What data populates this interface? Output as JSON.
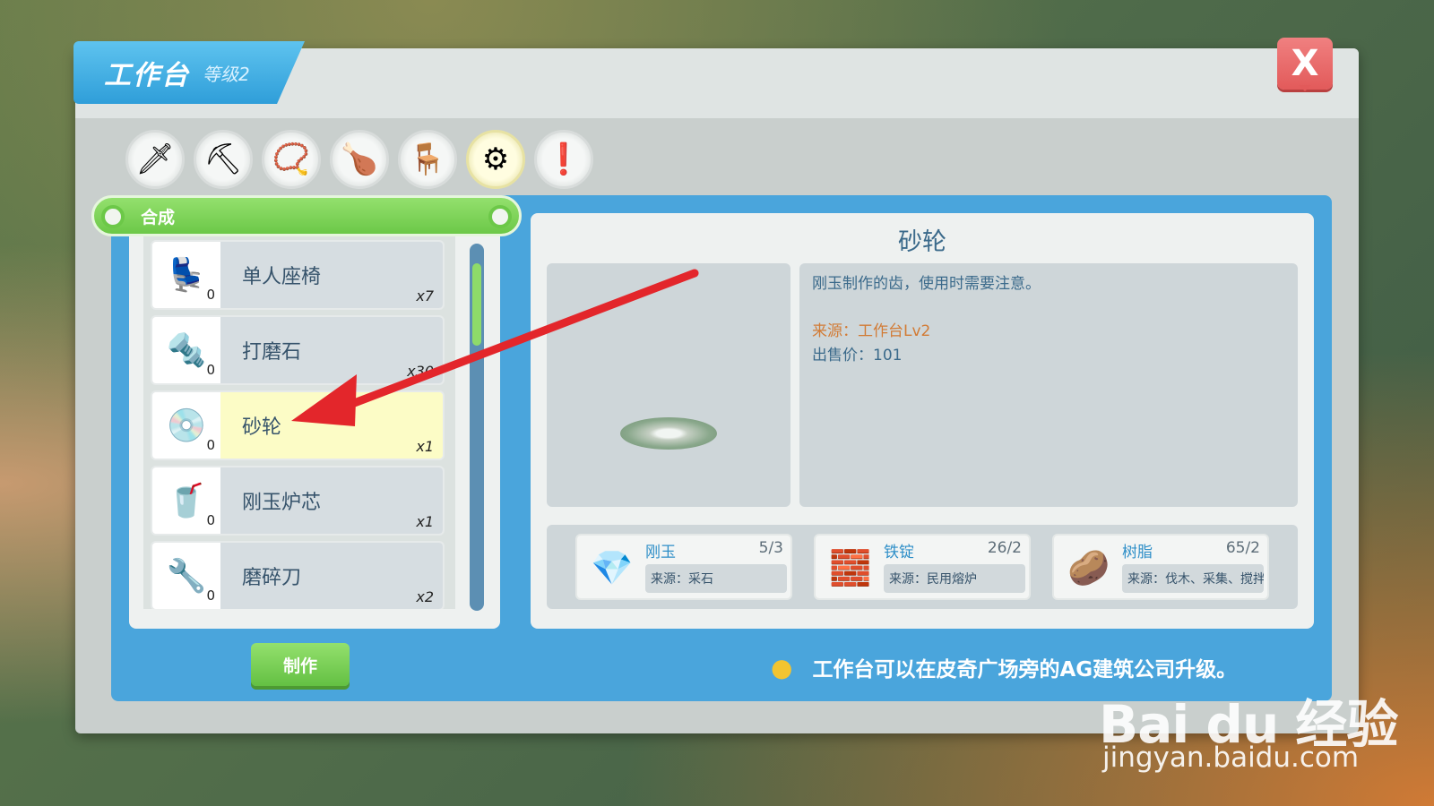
{
  "window": {
    "title": "工作台",
    "level": "等级2",
    "close_label": "X"
  },
  "categories": [
    {
      "icon": "sword-icon",
      "glyph": "🗡"
    },
    {
      "icon": "pickaxe-icon",
      "glyph": "⛏"
    },
    {
      "icon": "necklace-icon",
      "glyph": "📿"
    },
    {
      "icon": "meat-icon",
      "glyph": "🍗"
    },
    {
      "icon": "chair-icon",
      "glyph": "🪑"
    },
    {
      "icon": "gear-icon",
      "glyph": "⚙"
    },
    {
      "icon": "exclamation-icon",
      "glyph": "❗"
    }
  ],
  "section": {
    "label": "合成"
  },
  "items": [
    {
      "name": "单人座椅",
      "count": "0",
      "qty": "x7",
      "icon": "seat-icon",
      "glyph": "💺"
    },
    {
      "name": "打磨石",
      "count": "0",
      "qty": "x30",
      "icon": "grindstone-icon",
      "glyph": "🔩"
    },
    {
      "name": "砂轮",
      "count": "0",
      "qty": "x1",
      "icon": "grinding-wheel-icon",
      "glyph": "💿",
      "selected": true
    },
    {
      "name": "刚玉炉芯",
      "count": "0",
      "qty": "x1",
      "icon": "furnace-core-icon",
      "glyph": "🥤"
    },
    {
      "name": "磨碎刀",
      "count": "0",
      "qty": "x2",
      "icon": "grinder-blade-icon",
      "glyph": "🔧"
    }
  ],
  "make_button": "制作",
  "detail": {
    "title": "砂轮",
    "description": "刚玉制作的齿，使用时需要注意。",
    "source": "来源：工作台Lv2",
    "price": "出售价：101"
  },
  "materials": [
    {
      "name": "刚玉",
      "count": "5/3",
      "source": "来源：采石",
      "icon": "corundum-icon",
      "glyph": "💎"
    },
    {
      "name": "铁锭",
      "count": "26/2",
      "source": "来源：民用熔炉",
      "icon": "iron-ingot-icon",
      "glyph": "🧱"
    },
    {
      "name": "树脂",
      "count": "65/2",
      "source": "来源：伐木、采集、搅拌器",
      "icon": "resin-icon",
      "glyph": "🥔"
    }
  ],
  "tip": "工作台可以在皮奇广场旁的AG建筑公司升级。",
  "watermark": {
    "brand": "Bai du 经验",
    "url": "jingyan.baidu.com"
  },
  "colors": {
    "accent_blue": "#4aa5dc",
    "accent_green": "#6cc848",
    "close_red": "#e25a5a",
    "selected_item": "#fcfcc6"
  }
}
